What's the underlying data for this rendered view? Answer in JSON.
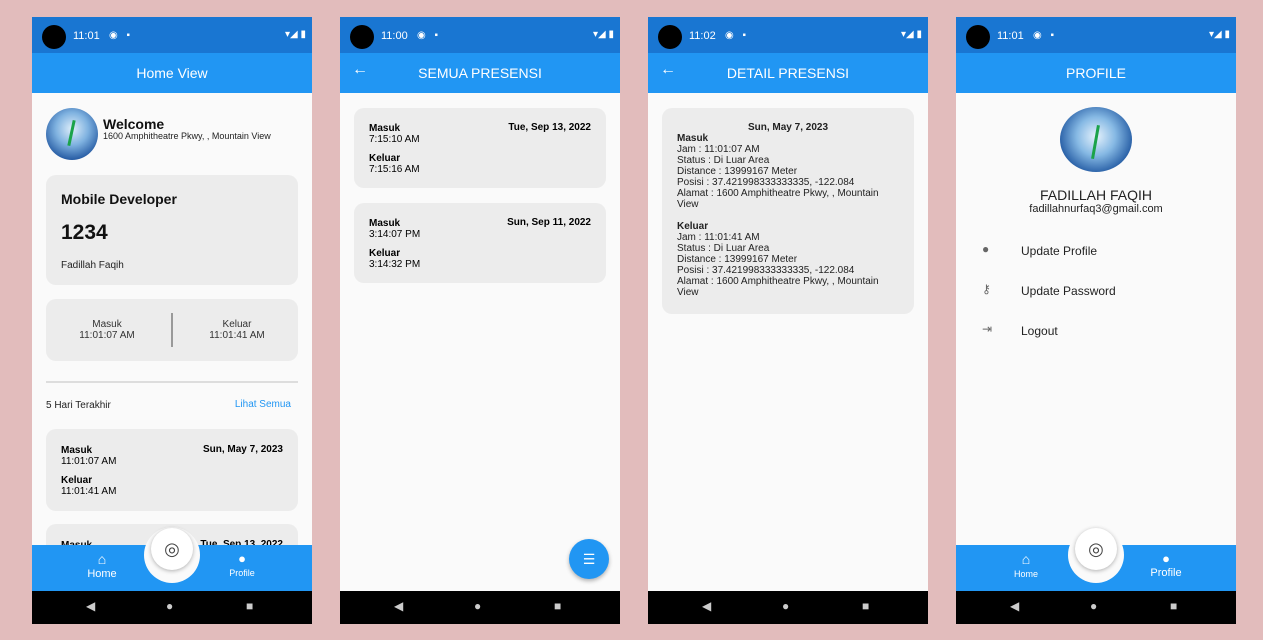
{
  "status": {
    "time_home": "11:01",
    "time_all": "11:00",
    "time_detail": "11:02",
    "time_profile": "11:01",
    "icons": "◉ ▪",
    "right": "▾◢ ▮"
  },
  "home": {
    "title": "Home View",
    "welcome": "Welcome",
    "address": "1600 Amphitheatre Pkwy, , Mountain View",
    "job": "Mobile Developer",
    "nip": "1234",
    "name": "Fadillah Faqih",
    "masuk_label": "Masuk",
    "masuk_time": "11:01:07 AM",
    "keluar_label": "Keluar",
    "keluar_time": "11:01:41 AM",
    "section": "5 Hari Terakhir",
    "see_all": "Lihat Semua",
    "records": [
      {
        "masuk": "Masuk",
        "masuk_time": "11:01:07 AM",
        "date": "Sun, May 7, 2023",
        "keluar": "Keluar",
        "keluar_time": "11:01:41 AM"
      },
      {
        "masuk": "Masuk",
        "date": "Tue, Sep 13, 2022"
      }
    ]
  },
  "nav": {
    "home": "Home",
    "profile": "Profile",
    "home_icon": "home-icon",
    "profile_icon": "person-icon",
    "finger_icon": "fingerprint-icon"
  },
  "all": {
    "title": "SEMUA PRESENSI",
    "records": [
      {
        "masuk": "Masuk",
        "masuk_time": "7:15:10 AM",
        "date": "Tue, Sep 13, 2022",
        "keluar": "Keluar",
        "keluar_time": "7:15:16 AM"
      },
      {
        "masuk": "Masuk",
        "masuk_time": "3:14:07 PM",
        "date": "Sun, Sep 11, 2022",
        "keluar": "Keluar",
        "keluar_time": "3:14:32 PM"
      }
    ]
  },
  "detail": {
    "title": "DETAIL PRESENSI",
    "date": "Sun, May 7, 2023",
    "masuk": {
      "label": "Masuk",
      "jam": "Jam : 11:01:07 AM",
      "status": "Status : Di Luar Area",
      "distance": "Distance : 13999167 Meter",
      "posisi": "Posisi : 37.421998333333335, -122.084",
      "alamat": "Alamat : 1600 Amphitheatre Pkwy, , Mountain View"
    },
    "keluar": {
      "label": "Keluar",
      "jam": "Jam : 11:01:41 AM",
      "status": "Status : Di Luar Area",
      "distance": "Distance : 13999167 Meter",
      "posisi": "Posisi : 37.421998333333335, -122.084",
      "alamat": "Alamat : 1600 Amphitheatre Pkwy, , Mountain View"
    }
  },
  "profile": {
    "title": "PROFILE",
    "name": "FADILLAH FAQIH",
    "email": "fadillahnurfaq3@gmail.com",
    "menu": [
      {
        "label": "Update Profile",
        "icon": "person-icon"
      },
      {
        "label": "Update Password",
        "icon": "key-icon"
      },
      {
        "label": "Logout",
        "icon": "logout-icon"
      }
    ]
  },
  "colors": {
    "primary": "#2196f3",
    "status": "#1976d2",
    "link": "#2196f3",
    "background": "#e2bcbc"
  }
}
